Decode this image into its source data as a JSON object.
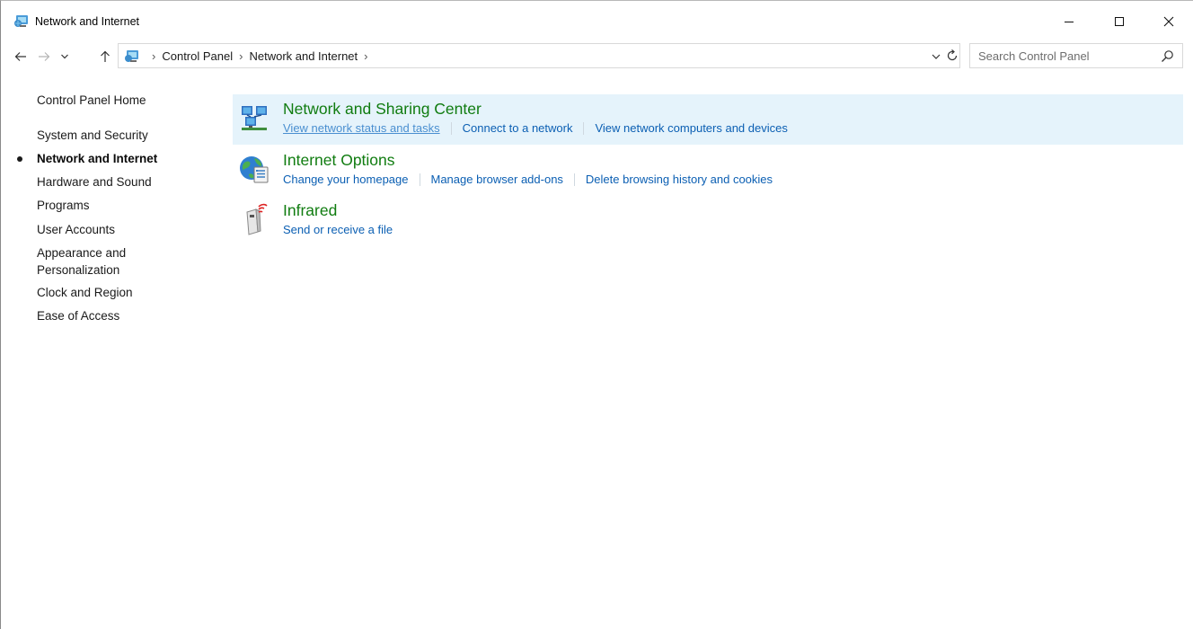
{
  "window": {
    "title": "Network and Internet",
    "controls": {
      "minimize": "minimize-icon",
      "maximize": "maximize-icon",
      "close": "close-icon"
    }
  },
  "nav": {
    "breadcrumbs": [
      {
        "label": "Control Panel"
      },
      {
        "label": "Network and Internet"
      }
    ],
    "search_placeholder": "Search Control Panel"
  },
  "sidebar": {
    "items": [
      {
        "label": "Control Panel Home"
      },
      {
        "label": "System and Security"
      },
      {
        "label": "Network and Internet",
        "current": true
      },
      {
        "label": "Hardware and Sound"
      },
      {
        "label": "Programs"
      },
      {
        "label": "User Accounts"
      },
      {
        "label": "Appearance and Personalization"
      },
      {
        "label": "Clock and Region"
      },
      {
        "label": "Ease of Access"
      }
    ]
  },
  "categories": [
    {
      "title": "Network and Sharing Center",
      "icon": "network-sharing-icon",
      "links": [
        {
          "label": "View network status and tasks"
        },
        {
          "label": "Connect to a network"
        },
        {
          "label": "View network computers and devices"
        }
      ]
    },
    {
      "title": "Internet Options",
      "icon": "internet-options-icon",
      "links": [
        {
          "label": "Change your homepage"
        },
        {
          "label": "Manage browser add-ons"
        },
        {
          "label": "Delete browsing history and cookies"
        }
      ]
    },
    {
      "title": "Infrared",
      "icon": "infrared-icon",
      "links": [
        {
          "label": "Send or receive a file"
        }
      ]
    }
  ],
  "colors": {
    "category_title": "#107c10",
    "link": "#0b5fb3",
    "hover_background": "#e5f3fb"
  }
}
